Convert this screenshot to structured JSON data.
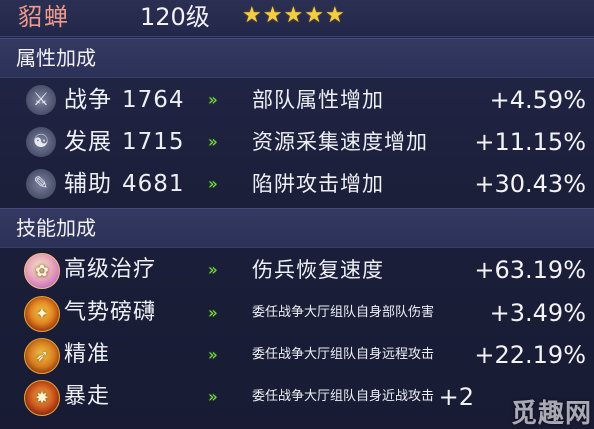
{
  "header": {
    "hero_name": "貂蝉",
    "level": "120级",
    "stars": [
      "★",
      "★",
      "★",
      "★",
      "★"
    ]
  },
  "attributes": {
    "title": "属性加成",
    "items": [
      {
        "icon": "crossed-swords-icon",
        "glyph": "⚔",
        "name": "战争",
        "value": "1764",
        "arrow": "»",
        "effect": "部队属性增加",
        "bonus": "+4.59%"
      },
      {
        "icon": "growth-icon",
        "glyph": "☯",
        "name": "发展",
        "value": "1715",
        "arrow": "»",
        "effect": "资源采集速度增加",
        "bonus": "+11.15%"
      },
      {
        "icon": "support-icon",
        "glyph": "✎",
        "name": "辅助",
        "value": "4681",
        "arrow": "»",
        "effect": "陷阱攻击增加",
        "bonus": "+30.43%"
      }
    ]
  },
  "skills": {
    "title": "技能加成",
    "items": [
      {
        "icon": "heal-skill-icon",
        "glyph": "✿",
        "name": "高级治疗",
        "arrow": "»",
        "effect": "伤兵恢复速度",
        "bonus": "+63.19%",
        "effect_size": "large"
      },
      {
        "icon": "momentum-skill-icon",
        "glyph": "✦",
        "name": "气势磅礴",
        "arrow": "»",
        "effect": "委任战争大厅组队自身部队伤害",
        "bonus": "+3.49%",
        "effect_size": "small"
      },
      {
        "icon": "precision-skill-icon",
        "glyph": "➶",
        "name": "精准",
        "arrow": "»",
        "effect": "委任战争大厅组队自身远程攻击",
        "bonus": "+22.19%",
        "effect_size": "small"
      },
      {
        "icon": "rage-skill-icon",
        "glyph": "✸",
        "name": "暴走",
        "arrow": "»",
        "effect": "委任战争大厅组队自身近战攻击",
        "bonus": "+2",
        "effect_size": "small"
      }
    ]
  },
  "watermark": "觅趣网"
}
